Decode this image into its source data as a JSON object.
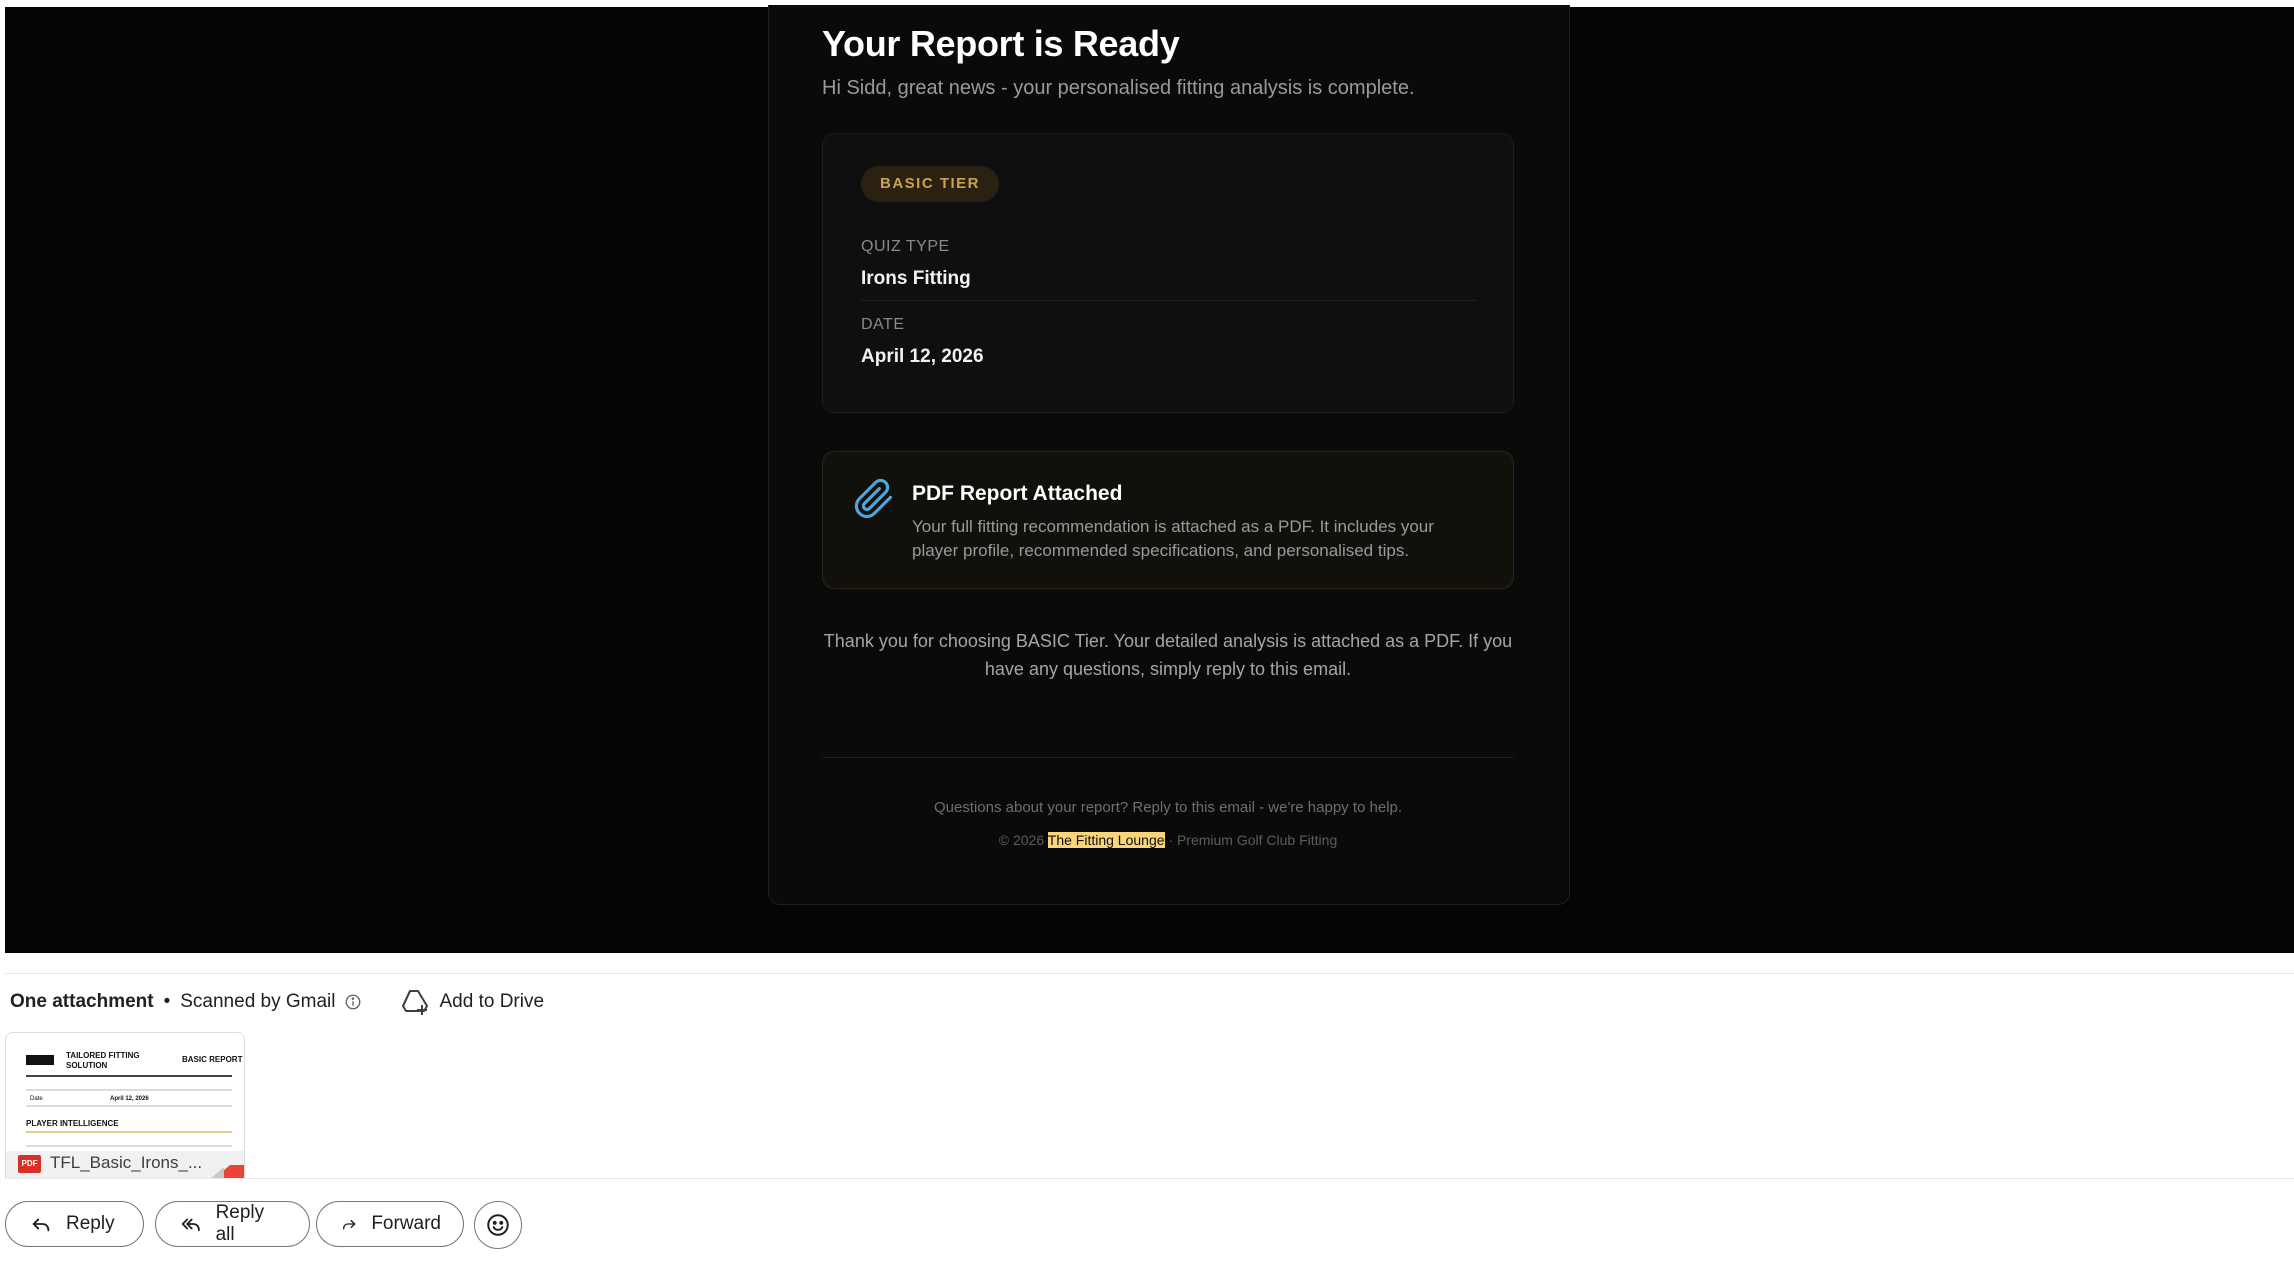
{
  "email": {
    "title": "Your Report is Ready",
    "greeting": "Hi Sidd, great news - your personalised fitting analysis is complete.",
    "tier_badge": "BASIC TIER",
    "quiz_type_label": "QUIZ TYPE",
    "quiz_type_value": "Irons Fitting",
    "date_label": "DATE",
    "date_value": "April 12, 2026",
    "pdf_notice": {
      "icon": "paperclip-icon",
      "title": "PDF Report Attached",
      "body": "Your full fitting recommendation is attached as a PDF. It includes your player profile, recommended specifications, and personalised tips."
    },
    "thanks": "Thank you for choosing BASIC Tier. Your detailed analysis is attached as a PDF. If you have any questions, simply reply to this email.",
    "footer_question": "Questions about your report? Reply to this email - we're happy to help.",
    "footer_copyright_prefix": "© 2026",
    "footer_brand": "The Fitting Lounge",
    "footer_copyright_suffix": "· Premium Golf Club Fitting",
    "colors": {
      "background": "#050505",
      "accent": "#caa052",
      "highlight": "#f8d47a"
    }
  },
  "attachments": {
    "count_label": "One attachment",
    "separator": "•",
    "scanned_label": "Scanned by Gmail",
    "add_to_drive_label": "Add to Drive",
    "file": {
      "name": "TFL_Basic_Irons_...",
      "type_badge": "PDF",
      "preview": {
        "heading_line1": "TAILORED FITTING",
        "heading_line2": "SOLUTION",
        "report_label": "BASIC REPORT",
        "date_label": "Date",
        "date_value": "April 12, 2026",
        "section": "PLAYER INTELLIGENCE"
      }
    }
  },
  "actions": {
    "reply_label": "Reply",
    "reply_all_label": "Reply all",
    "forward_label": "Forward",
    "emoji_icon": "emoji-reaction-icon"
  }
}
